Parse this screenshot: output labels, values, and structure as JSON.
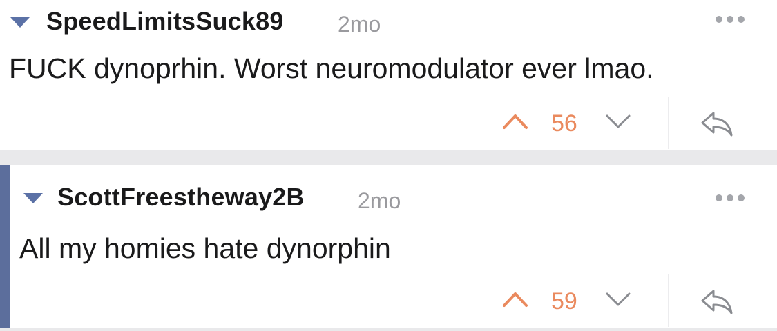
{
  "comments": [
    {
      "username": "SpeedLimitsSuck89",
      "age": "2mo",
      "body": "FUCK dynoprhin.  Worst neuromodulator ever lmao.",
      "score": "56"
    },
    {
      "username": "ScottFreestheway2B",
      "age": "2mo",
      "body": "All my homies hate dynorphin",
      "score": "59"
    }
  ],
  "colors": {
    "upvote": "#ea8a5e",
    "downvote": "#8a8c91",
    "thread_line": "#5c6e9c",
    "collapse_arrow": "#5b71a6",
    "separator": "#e9e9eb"
  },
  "icons": {
    "collapse": "triangle-down-icon",
    "more": "more-horizontal-icon",
    "upvote": "chevron-up-icon",
    "downvote": "chevron-down-icon",
    "reply": "reply-arrow-icon"
  }
}
